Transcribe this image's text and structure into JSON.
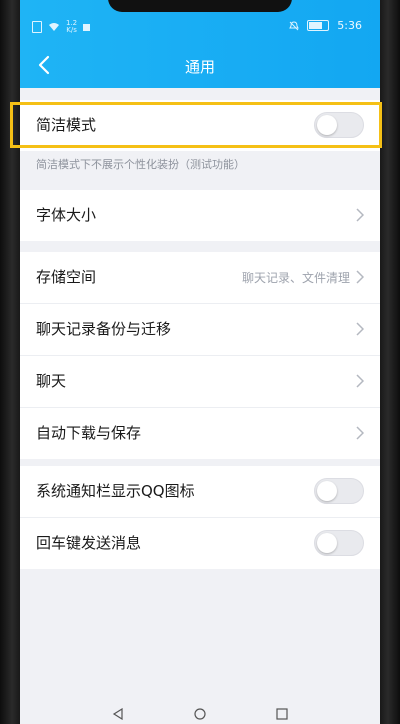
{
  "status_bar": {
    "net_speed_value": "1.2",
    "net_speed_unit": "K/s",
    "time": "5:36"
  },
  "header": {
    "title": "通用"
  },
  "simple_mode": {
    "label": "简洁模式",
    "enabled": false,
    "hint": "简洁模式下不展示个性化装扮（测试功能）"
  },
  "font_size": {
    "label": "字体大小"
  },
  "storage_group": {
    "items": [
      {
        "label": "存储空间",
        "sub": "聊天记录、文件清理"
      },
      {
        "label": "聊天记录备份与迁移"
      },
      {
        "label": "聊天"
      },
      {
        "label": "自动下载与保存"
      }
    ]
  },
  "toggles_group": {
    "items": [
      {
        "label": "系统通知栏显示QQ图标",
        "enabled": false
      },
      {
        "label": "回车键发送消息",
        "enabled": false
      }
    ]
  },
  "colors": {
    "header": "#13a7f2",
    "highlight": "#f5c016",
    "background": "#f0f1f5"
  },
  "icons": [
    "back-icon",
    "chevron-right-icon",
    "wifi-icon",
    "battery-icon",
    "bell-mute-icon",
    "sim-icon"
  ]
}
